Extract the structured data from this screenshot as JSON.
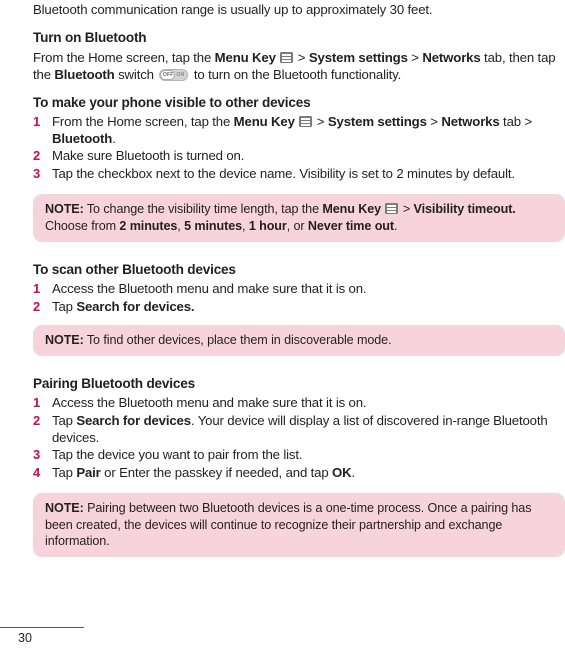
{
  "page": {
    "number": "30",
    "accent_color": "#d2094f",
    "note_background": "#f7d4dc",
    "text_color": "#231f20"
  },
  "intro": {
    "text": "Bluetooth communication range is usually up to approximately 30 feet."
  },
  "sections": [
    {
      "heading": "Turn on Bluetooth",
      "paragraph": {
        "seg1": "From the Home screen, tap the ",
        "bold1": "Menu Key",
        "icon1": "menu-key-icon",
        "seg2": " > ",
        "bold2": "System settings",
        "seg3": " > ",
        "bold3": "Networks",
        "seg4": " tab, then tap the ",
        "bold4": "Bluetooth",
        "seg5": " switch ",
        "icon2": "toggle-switch-icon",
        "seg6": " to turn on the Bluetooth functionality."
      }
    },
    {
      "heading": "To make your phone visible to other devices",
      "steps": [
        {
          "num": "1",
          "seg1": "From the Home screen, tap the ",
          "bold1": "Menu Key",
          "icon1": "menu-key-icon",
          "seg2": " > ",
          "bold2": "System settings",
          "seg3": " > ",
          "bold3": "Networks",
          "seg4": " tab > ",
          "bold4": "Bluetooth",
          "seg5": "."
        },
        {
          "num": "2",
          "text": "Make sure Bluetooth is turned on."
        },
        {
          "num": "3",
          "text": "Tap the checkbox next to the device name. Visibility is set to 2 minutes by default."
        }
      ],
      "note": {
        "label": "NOTE:",
        "seg1": " To change the visibility time length, tap the ",
        "bold1": "Menu Key",
        "icon1": "menu-key-icon",
        "seg2": " > ",
        "bold2": "Visibility timeout.",
        "seg3": " Choose from ",
        "bold3": "2 minutes",
        "seg4": ", ",
        "bold4": "5 minutes",
        "seg5": ", ",
        "bold5": "1 hour",
        "seg6": ", or ",
        "bold6": "Never time out",
        "seg7": "."
      }
    },
    {
      "heading": "To scan other Bluetooth devices",
      "steps": [
        {
          "num": "1",
          "text": "Access the Bluetooth menu and make sure that it is on."
        },
        {
          "num": "2",
          "seg1": "Tap ",
          "bold1": "Search for devices.",
          "seg2": ""
        }
      ],
      "note": {
        "label": "NOTE:",
        "seg1": " To find other devices, place them in discoverable mode."
      }
    },
    {
      "heading": "Pairing Bluetooth devices",
      "steps": [
        {
          "num": "1",
          "text": "Access the Bluetooth menu and make sure that it is on."
        },
        {
          "num": "2",
          "seg1": "Tap ",
          "bold1": "Search for devices",
          "seg2": ". Your device will display a list of discovered in-range Bluetooth devices."
        },
        {
          "num": "3",
          "text": "Tap the device you want to pair from the list."
        },
        {
          "num": "4",
          "seg1": "Tap ",
          "bold1": "Pair",
          "seg2": " or Enter the passkey if needed, and tap ",
          "bold2": "OK",
          "seg3": "."
        }
      ],
      "note": {
        "label": "NOTE:",
        "seg1": " Pairing between two Bluetooth devices is a one-time process. Once a pairing has been created, the devices will continue to recognize their partnership and exchange information."
      }
    }
  ],
  "icons": {
    "menu_key": {
      "name": "menu-key-icon"
    },
    "toggle_switch": {
      "name": "toggle-switch-icon",
      "off_label": "OFF",
      "on_label": "ON"
    }
  }
}
